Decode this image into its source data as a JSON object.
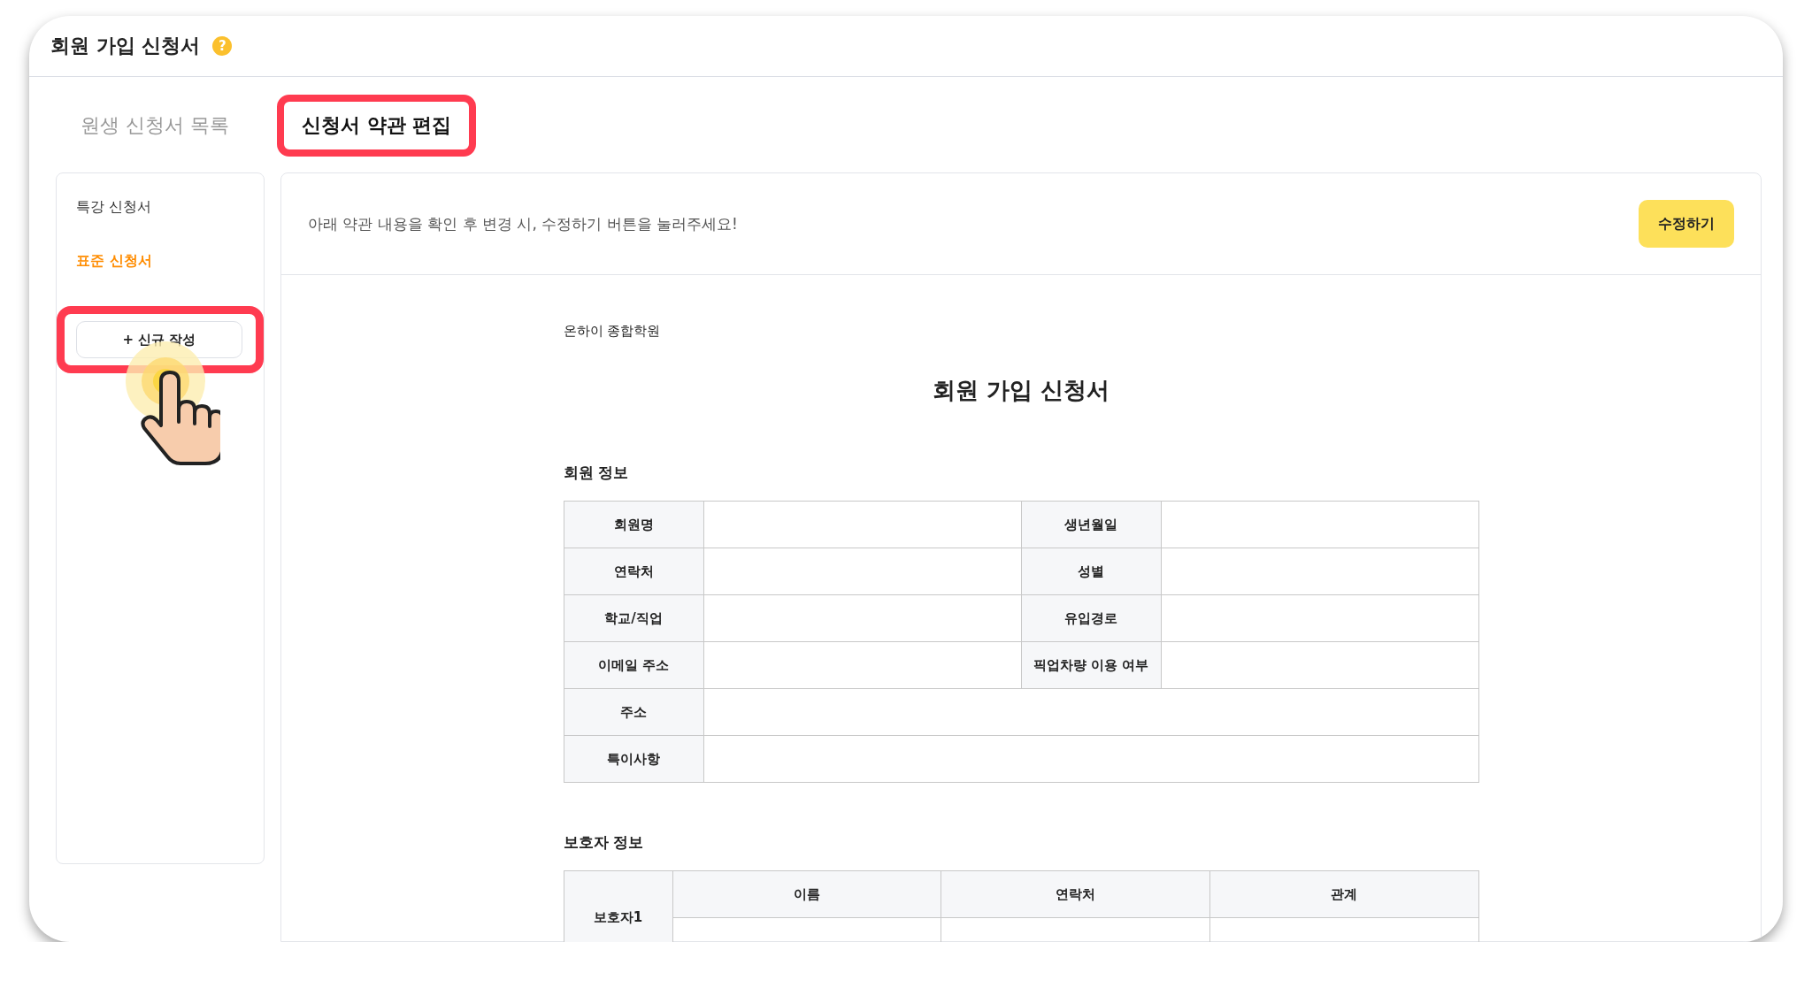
{
  "header": {
    "title": "회원 가입 신청서",
    "help_icon": "?"
  },
  "tabs": [
    {
      "label": "원생 신청서 목록",
      "selected": false,
      "highlighted": false
    },
    {
      "label": "신청서 약관 편집",
      "selected": true,
      "highlighted": true
    }
  ],
  "sidebar": {
    "items": [
      {
        "label": "특강 신청서",
        "selected": false
      },
      {
        "label": "표준 신청서",
        "selected": true
      }
    ],
    "new_button": {
      "label": "+ 신규 작성",
      "highlighted": true,
      "pointer": true
    }
  },
  "notice": {
    "text": "아래 약관 내용을 확인 후 변경 시, 수정하기 버튼을 눌러주세요!",
    "button": "수정하기"
  },
  "document": {
    "academy": "온하이 종합학원",
    "title": "회원 가입 신청서",
    "member_info": {
      "heading": "회원 정보",
      "rows": [
        [
          "회원명",
          "생년월일"
        ],
        [
          "연락처",
          "성별"
        ],
        [
          "학교/직업",
          "유입경로"
        ],
        [
          "이메일 주소",
          "픽업차량 이용 여부"
        ],
        [
          "주소"
        ],
        [
          "특이사항"
        ]
      ]
    },
    "guardian_info": {
      "heading": "보호자 정보",
      "label": "보호자1",
      "columns": [
        "이름",
        "연락처",
        "관계"
      ]
    }
  }
}
